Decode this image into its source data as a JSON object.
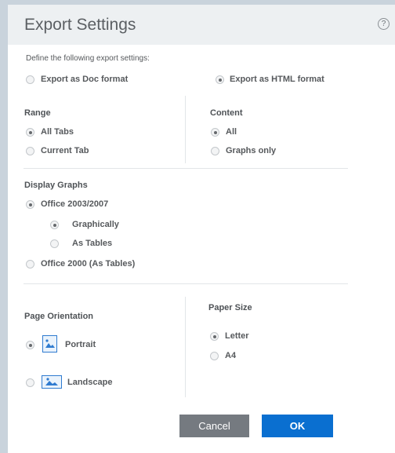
{
  "dialog": {
    "title": "Export Settings",
    "help_icon": "?",
    "intro": "Define the following export settings:",
    "colors": {
      "accent": "#0a6fd0",
      "cancel": "#757a80",
      "titlebar": "#edf0f2"
    }
  },
  "format": {
    "doc_label": "Export as Doc format",
    "html_label": "Export as HTML format",
    "selected": "html"
  },
  "range": {
    "heading": "Range",
    "all_tabs": "All Tabs",
    "current_tab": "Current Tab",
    "selected": "all_tabs"
  },
  "content": {
    "heading": "Content",
    "all": "All",
    "graphs_only": "Graphs only",
    "selected": "all"
  },
  "display_graphs": {
    "heading": "Display Graphs",
    "office_2003": "Office 2003/2007",
    "graphically": "Graphically",
    "as_tables": "As Tables",
    "office_2000": "Office 2000 (As Tables)",
    "selected": "office_2003",
    "sub_selected": "graphically"
  },
  "orientation": {
    "heading": "Page Orientation",
    "portrait": "Portrait",
    "landscape": "Landscape",
    "selected": "portrait",
    "icons": [
      "portrait-page-icon",
      "landscape-page-icon"
    ]
  },
  "paper": {
    "heading": "Paper Size",
    "letter": "Letter",
    "a4": "A4",
    "selected": "letter"
  },
  "buttons": {
    "cancel": "Cancel",
    "ok": "OK"
  }
}
